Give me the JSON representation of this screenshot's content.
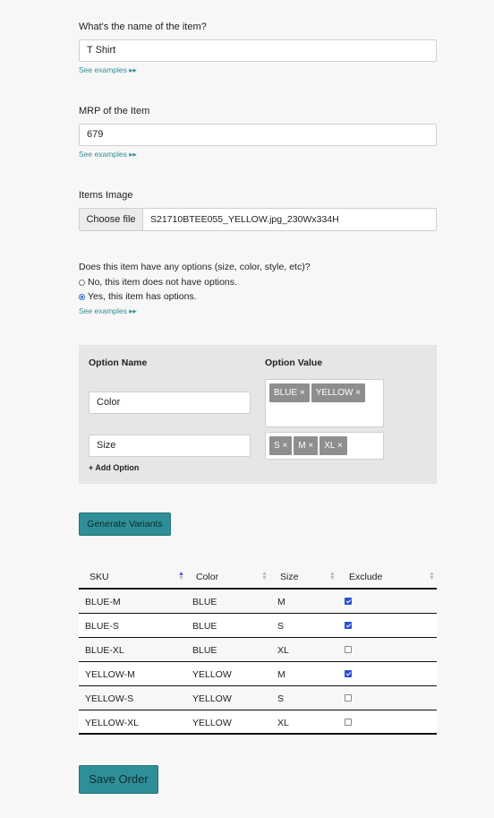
{
  "item_name": {
    "label": "What's the name of the item?",
    "value": "T Shirt",
    "see_examples": "See examples ▸▸"
  },
  "mrp": {
    "label": "MRP of the Item",
    "value": "679",
    "see_examples": "See examples ▸▸"
  },
  "image": {
    "label": "Items Image",
    "button": "Choose file",
    "filename": "S21710BTEE055_YELLOW.jpg_230Wx334H"
  },
  "options_question": {
    "label": "Does this item have any options (size, color, style, etc)?",
    "no_label": "No, this item does not have options.",
    "yes_label": "Yes, this item has options.",
    "selected": "yes",
    "see_examples": "See examples ▸▸"
  },
  "options_panel": {
    "name_header": "Option Name",
    "value_header": "Option Value",
    "options": [
      {
        "name": "Color",
        "values": [
          "BLUE ×",
          "YELLOW ×"
        ]
      },
      {
        "name": "Size",
        "values": [
          "S ×",
          "M ×",
          "XL ×"
        ]
      }
    ],
    "add_option": "+ Add Option"
  },
  "generate_button": "Generate Variants",
  "table": {
    "headers": {
      "sku": "SKU",
      "color": "Color",
      "size": "Size",
      "exclude": "Exclude"
    },
    "sorted_by": "SKU",
    "rows": [
      {
        "sku": "BLUE-M",
        "color": "BLUE",
        "size": "M",
        "exclude": true
      },
      {
        "sku": "BLUE-S",
        "color": "BLUE",
        "size": "S",
        "exclude": true
      },
      {
        "sku": "BLUE-XL",
        "color": "BLUE",
        "size": "XL",
        "exclude": false
      },
      {
        "sku": "YELLOW-M",
        "color": "YELLOW",
        "size": "M",
        "exclude": true
      },
      {
        "sku": "YELLOW-S",
        "color": "YELLOW",
        "size": "S",
        "exclude": false
      },
      {
        "sku": "YELLOW-XL",
        "color": "YELLOW",
        "size": "XL",
        "exclude": false
      }
    ]
  },
  "save_button": "Save Order",
  "colors": {
    "accent": "#2f8f98",
    "checkbox": "#2b4fd6"
  }
}
